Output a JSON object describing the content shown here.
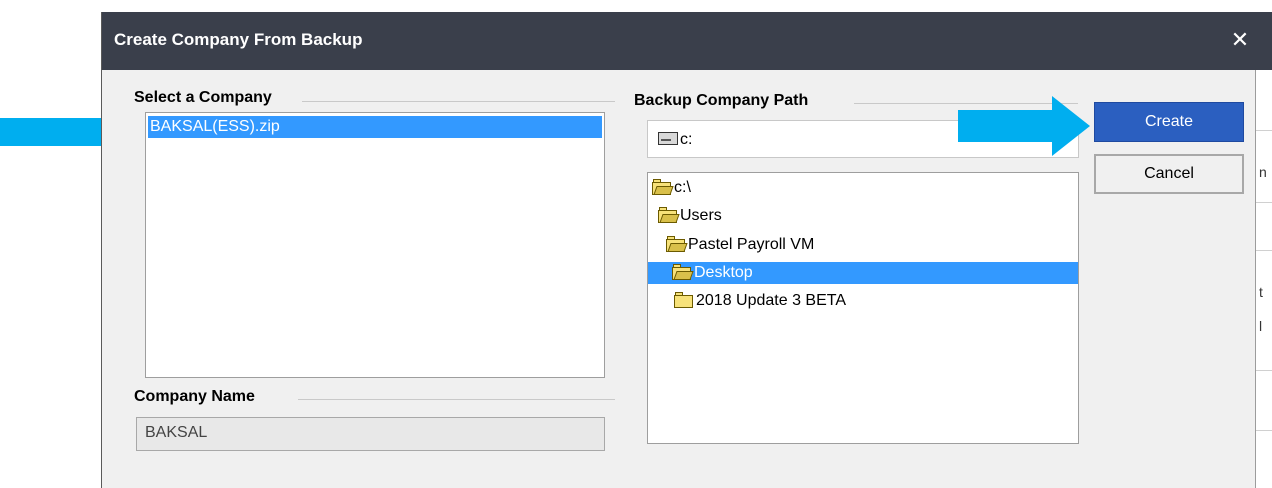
{
  "dialog": {
    "title": "Create Company From Backup",
    "close_glyph": "✕"
  },
  "select_company": {
    "label": "Select a Company",
    "items": [
      "BAKSAL(ESS).zip"
    ],
    "selected_index": 0
  },
  "company_name": {
    "label": "Company Name",
    "value": "BAKSAL"
  },
  "backup_path": {
    "label": "Backup Company Path",
    "drive": "c:",
    "tree": [
      {
        "label": "c:\\",
        "level": 0
      },
      {
        "label": "Users",
        "level": 1
      },
      {
        "label": "Pastel Payroll VM",
        "level": 2
      },
      {
        "label": "Desktop",
        "level": 3,
        "selected": true
      },
      {
        "label": "2018 Update 3 BETA",
        "level": 4
      }
    ]
  },
  "buttons": {
    "create": "Create",
    "cancel": "Cancel"
  },
  "background_window": {
    "glyphs": [
      "n",
      "t",
      "l"
    ]
  },
  "colors": {
    "titlebar": "#3a3f4b",
    "selection": "#3399ff",
    "create_button": "#2b5fc0",
    "arrow": "#00aeef",
    "folder": "#f7e27a"
  },
  "icons": {
    "close": "close-icon",
    "drive": "drive-icon",
    "folder": "folder-icon",
    "folder_open": "folder-open-icon",
    "annotation_arrow": "arrow-right-icon"
  }
}
